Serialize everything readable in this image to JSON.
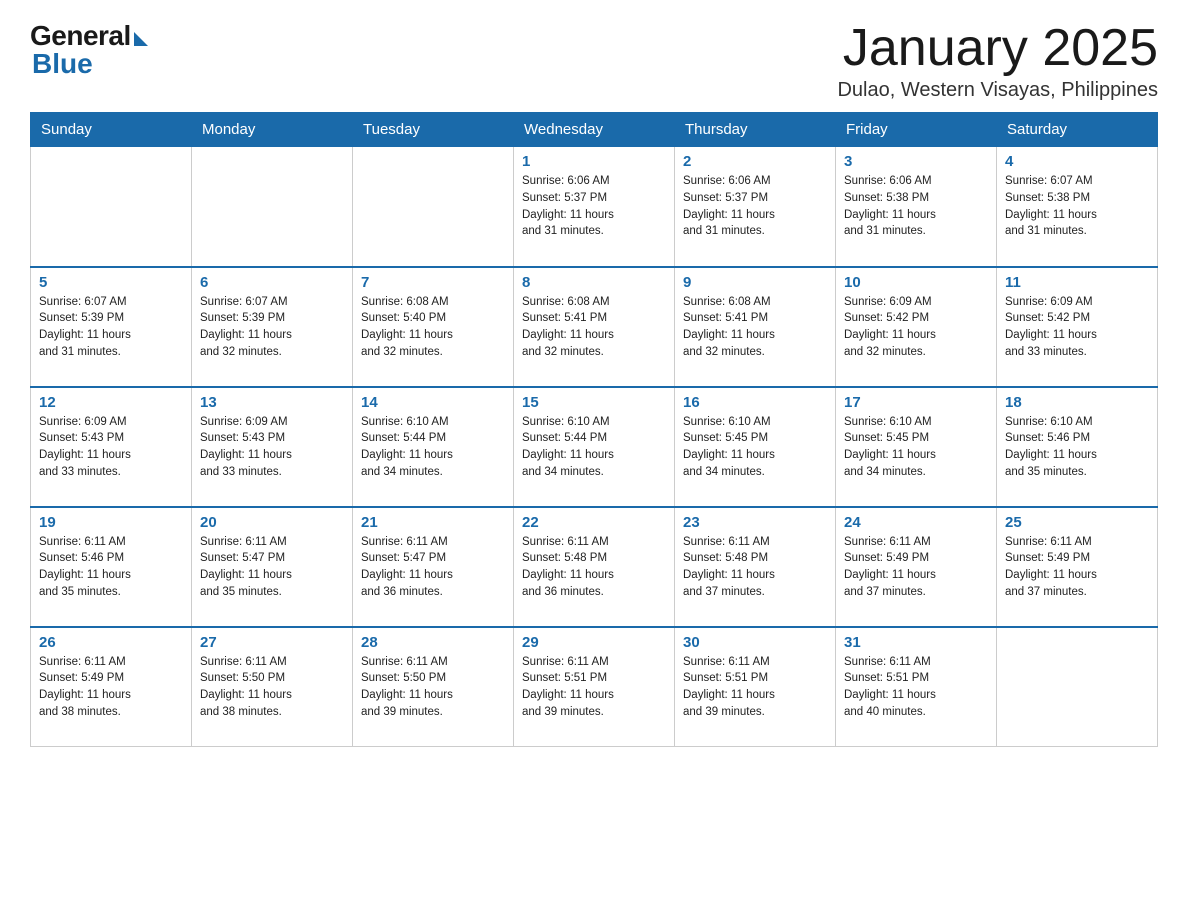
{
  "logo": {
    "general": "General",
    "blue": "Blue"
  },
  "title": "January 2025",
  "location": "Dulao, Western Visayas, Philippines",
  "days_of_week": [
    "Sunday",
    "Monday",
    "Tuesday",
    "Wednesday",
    "Thursday",
    "Friday",
    "Saturday"
  ],
  "weeks": [
    [
      {
        "day": "",
        "info": ""
      },
      {
        "day": "",
        "info": ""
      },
      {
        "day": "",
        "info": ""
      },
      {
        "day": "1",
        "info": "Sunrise: 6:06 AM\nSunset: 5:37 PM\nDaylight: 11 hours\nand 31 minutes."
      },
      {
        "day": "2",
        "info": "Sunrise: 6:06 AM\nSunset: 5:37 PM\nDaylight: 11 hours\nand 31 minutes."
      },
      {
        "day": "3",
        "info": "Sunrise: 6:06 AM\nSunset: 5:38 PM\nDaylight: 11 hours\nand 31 minutes."
      },
      {
        "day": "4",
        "info": "Sunrise: 6:07 AM\nSunset: 5:38 PM\nDaylight: 11 hours\nand 31 minutes."
      }
    ],
    [
      {
        "day": "5",
        "info": "Sunrise: 6:07 AM\nSunset: 5:39 PM\nDaylight: 11 hours\nand 31 minutes."
      },
      {
        "day": "6",
        "info": "Sunrise: 6:07 AM\nSunset: 5:39 PM\nDaylight: 11 hours\nand 32 minutes."
      },
      {
        "day": "7",
        "info": "Sunrise: 6:08 AM\nSunset: 5:40 PM\nDaylight: 11 hours\nand 32 minutes."
      },
      {
        "day": "8",
        "info": "Sunrise: 6:08 AM\nSunset: 5:41 PM\nDaylight: 11 hours\nand 32 minutes."
      },
      {
        "day": "9",
        "info": "Sunrise: 6:08 AM\nSunset: 5:41 PM\nDaylight: 11 hours\nand 32 minutes."
      },
      {
        "day": "10",
        "info": "Sunrise: 6:09 AM\nSunset: 5:42 PM\nDaylight: 11 hours\nand 32 minutes."
      },
      {
        "day": "11",
        "info": "Sunrise: 6:09 AM\nSunset: 5:42 PM\nDaylight: 11 hours\nand 33 minutes."
      }
    ],
    [
      {
        "day": "12",
        "info": "Sunrise: 6:09 AM\nSunset: 5:43 PM\nDaylight: 11 hours\nand 33 minutes."
      },
      {
        "day": "13",
        "info": "Sunrise: 6:09 AM\nSunset: 5:43 PM\nDaylight: 11 hours\nand 33 minutes."
      },
      {
        "day": "14",
        "info": "Sunrise: 6:10 AM\nSunset: 5:44 PM\nDaylight: 11 hours\nand 34 minutes."
      },
      {
        "day": "15",
        "info": "Sunrise: 6:10 AM\nSunset: 5:44 PM\nDaylight: 11 hours\nand 34 minutes."
      },
      {
        "day": "16",
        "info": "Sunrise: 6:10 AM\nSunset: 5:45 PM\nDaylight: 11 hours\nand 34 minutes."
      },
      {
        "day": "17",
        "info": "Sunrise: 6:10 AM\nSunset: 5:45 PM\nDaylight: 11 hours\nand 34 minutes."
      },
      {
        "day": "18",
        "info": "Sunrise: 6:10 AM\nSunset: 5:46 PM\nDaylight: 11 hours\nand 35 minutes."
      }
    ],
    [
      {
        "day": "19",
        "info": "Sunrise: 6:11 AM\nSunset: 5:46 PM\nDaylight: 11 hours\nand 35 minutes."
      },
      {
        "day": "20",
        "info": "Sunrise: 6:11 AM\nSunset: 5:47 PM\nDaylight: 11 hours\nand 35 minutes."
      },
      {
        "day": "21",
        "info": "Sunrise: 6:11 AM\nSunset: 5:47 PM\nDaylight: 11 hours\nand 36 minutes."
      },
      {
        "day": "22",
        "info": "Sunrise: 6:11 AM\nSunset: 5:48 PM\nDaylight: 11 hours\nand 36 minutes."
      },
      {
        "day": "23",
        "info": "Sunrise: 6:11 AM\nSunset: 5:48 PM\nDaylight: 11 hours\nand 37 minutes."
      },
      {
        "day": "24",
        "info": "Sunrise: 6:11 AM\nSunset: 5:49 PM\nDaylight: 11 hours\nand 37 minutes."
      },
      {
        "day": "25",
        "info": "Sunrise: 6:11 AM\nSunset: 5:49 PM\nDaylight: 11 hours\nand 37 minutes."
      }
    ],
    [
      {
        "day": "26",
        "info": "Sunrise: 6:11 AM\nSunset: 5:49 PM\nDaylight: 11 hours\nand 38 minutes."
      },
      {
        "day": "27",
        "info": "Sunrise: 6:11 AM\nSunset: 5:50 PM\nDaylight: 11 hours\nand 38 minutes."
      },
      {
        "day": "28",
        "info": "Sunrise: 6:11 AM\nSunset: 5:50 PM\nDaylight: 11 hours\nand 39 minutes."
      },
      {
        "day": "29",
        "info": "Sunrise: 6:11 AM\nSunset: 5:51 PM\nDaylight: 11 hours\nand 39 minutes."
      },
      {
        "day": "30",
        "info": "Sunrise: 6:11 AM\nSunset: 5:51 PM\nDaylight: 11 hours\nand 39 minutes."
      },
      {
        "day": "31",
        "info": "Sunrise: 6:11 AM\nSunset: 5:51 PM\nDaylight: 11 hours\nand 40 minutes."
      },
      {
        "day": "",
        "info": ""
      }
    ]
  ]
}
